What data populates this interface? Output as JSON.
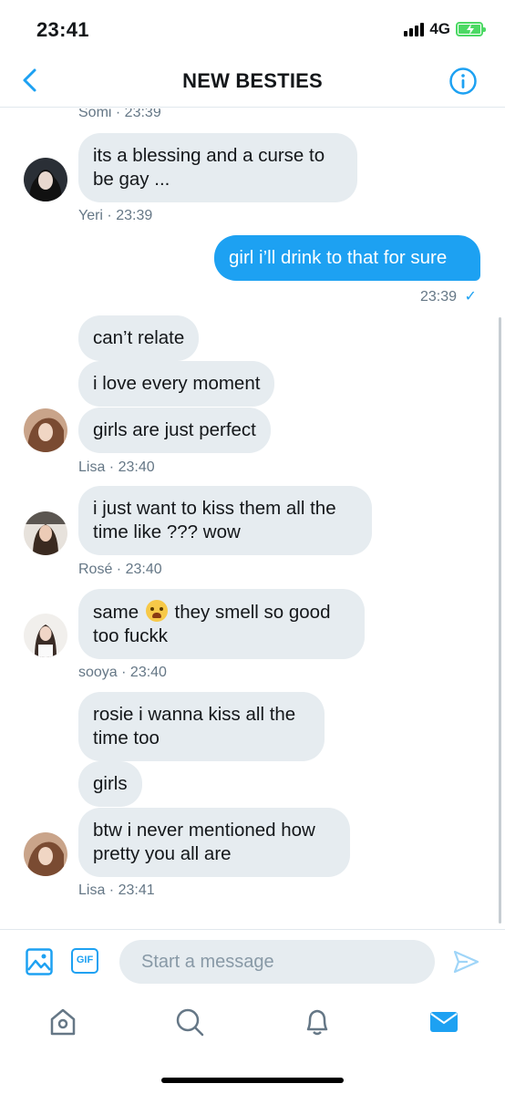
{
  "status_bar": {
    "time": "23:41",
    "network": "4G"
  },
  "header": {
    "title": "NEW BESTIES"
  },
  "messages": {
    "m0_meta": "Somi · 23:39",
    "m1": {
      "text": "its a blessing and a curse to be gay ...",
      "meta": "Yeri · 23:39"
    },
    "m2": {
      "text": "girl i’ll drink to that for sure",
      "meta": "23:39",
      "check": "✓"
    },
    "m3": {
      "lines": [
        "can’t relate",
        "i love every moment",
        "girls are just perfect"
      ],
      "meta": "Lisa  · 23:40"
    },
    "m4": {
      "text": "i just want to kiss them all the time like ??? wow",
      "meta": "Rosé · 23:40"
    },
    "m5": {
      "before": "same",
      "after": "they smell so good",
      "line2": "too fuckk",
      "meta": "sooya · 23:40"
    },
    "m6": {
      "lines": [
        "rosie i wanna kiss all the time too",
        "girls",
        "btw i never mentioned how pretty you all are"
      ],
      "meta": "Lisa  · 23:41"
    }
  },
  "composer": {
    "placeholder": "Start a message",
    "gif_label": "GIF"
  },
  "colors": {
    "accent": "#1da1f2",
    "bubble_in": "#e6ecf0",
    "meta_text": "#657786"
  },
  "icons": [
    "back-chevron-icon",
    "info-icon",
    "photo-icon",
    "gif-icon",
    "send-icon",
    "home-icon",
    "search-icon",
    "bell-icon",
    "mail-icon"
  ]
}
